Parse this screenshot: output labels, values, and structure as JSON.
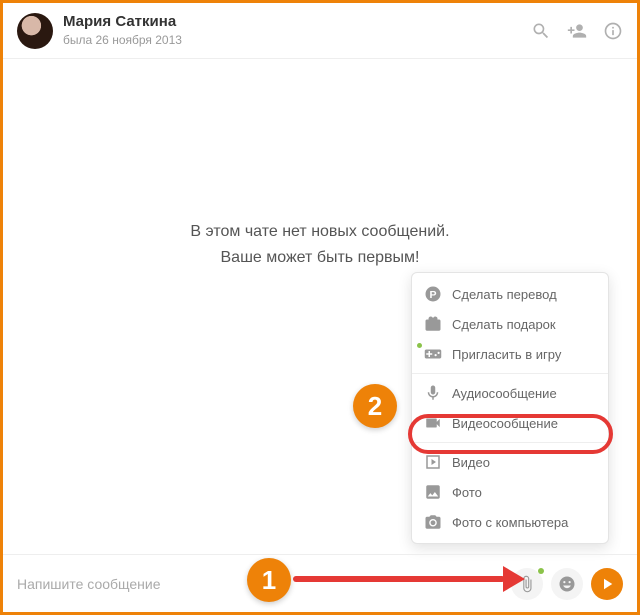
{
  "header": {
    "name": "Мария Саткина",
    "status": "была 26 ноября 2013"
  },
  "empty": {
    "line1": "В этом чате нет новых сообщений.",
    "line2": "Ваше может быть первым!"
  },
  "popup": {
    "transfer": "Сделать перевод",
    "gift": "Сделать подарок",
    "invite": "Пригласить в игру",
    "audio": "Аудиосообщение",
    "videoMsg": "Видеосообщение",
    "video": "Видео",
    "photo": "Фото",
    "upload": "Фото с компьютера"
  },
  "input": {
    "placeholder": "Напишите сообщение"
  },
  "annotations": {
    "step1": "1",
    "step2": "2"
  }
}
